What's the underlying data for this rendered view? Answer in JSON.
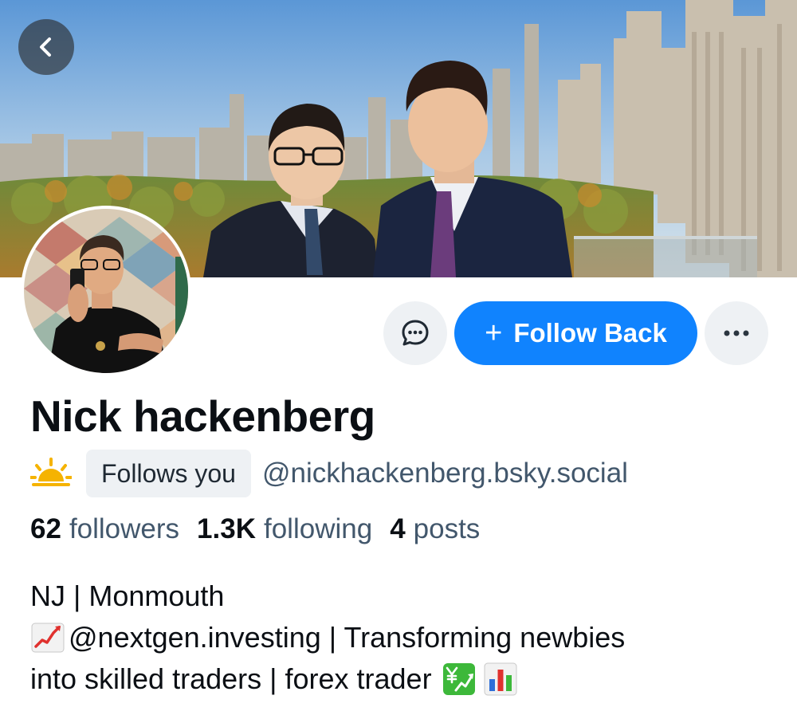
{
  "header": {
    "back_icon": "chevron-left-icon"
  },
  "profile": {
    "display_name": "Nick hackenberg",
    "status_icon": "sun-icon",
    "follows_you_label": "Follows you",
    "handle": "@nickhackenberg.bsky.social"
  },
  "actions": {
    "message_icon": "chat-bubble-icon",
    "follow_back_label": "Follow Back",
    "follow_plus": "+",
    "more_icon": "ellipsis-icon"
  },
  "stats": {
    "followers_count": "62",
    "followers_label": "followers",
    "following_count": "1.3K",
    "following_label": "following",
    "posts_count": "4",
    "posts_label": "posts"
  },
  "bio": {
    "line1": "NJ | Monmouth",
    "line2": "@nextgen.investing | Transforming newbies",
    "line3": "into skilled traders | forex trader",
    "line2_emoji": "chart-increasing-icon",
    "line3_emojis": [
      "chart-yen-icon",
      "bar-chart-icon"
    ]
  },
  "colors": {
    "accent": "#1083fe",
    "secondary_text": "#42576c",
    "button_bg": "#eef1f4"
  }
}
